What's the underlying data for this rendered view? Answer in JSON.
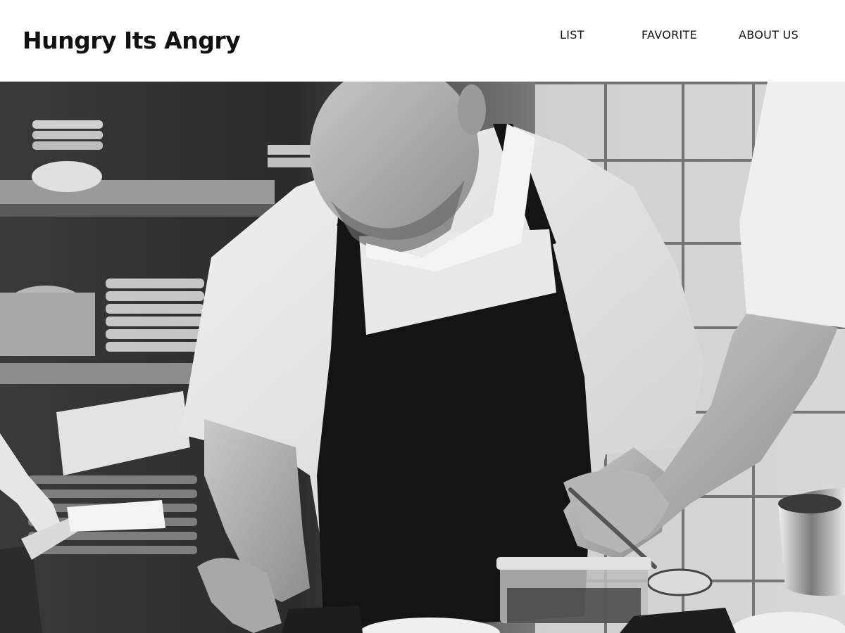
{
  "header": {
    "brand": "Hungry Its Angry",
    "nav": [
      {
        "label": "LIST"
      },
      {
        "label": "FAVORITE"
      },
      {
        "label": "ABOUT US"
      }
    ]
  },
  "hero": {
    "image_description_icon": "chef-photo"
  }
}
